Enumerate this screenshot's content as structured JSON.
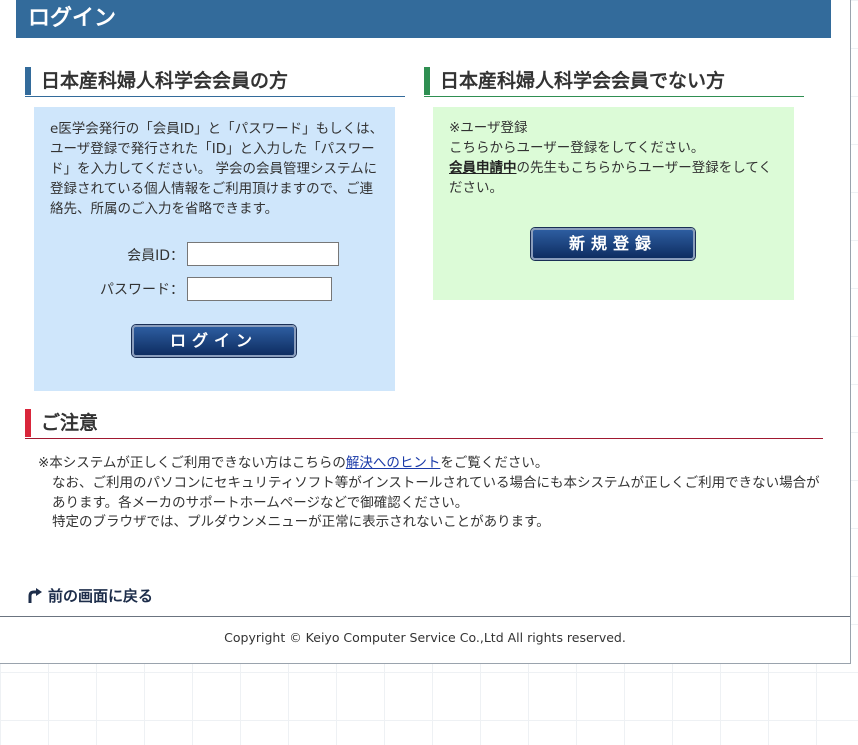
{
  "header": {
    "title": "ログイン"
  },
  "member_section": {
    "heading": "日本産科婦人科学会会員の方",
    "intro": "e医学会発行の「会員ID」と「パスワード」もしくは、ユーザ登録で発行された「ID」と入力した「パスワード」を入力してください。 学会の会員管理システムに登録されている個人情報をご利用頂けますので、ご連絡先、所属のご入力を省略できます。",
    "member_id_label": "会員ID：",
    "password_label": "パスワード：",
    "member_id_value": "",
    "password_value": "",
    "login_button": "ログイン"
  },
  "nonmember_section": {
    "heading": "日本産科婦人科学会会員でない方",
    "line1": "※ユーザ登録",
    "line2": "こちらからユーザー登録をしてください。",
    "line3_link": "会員申請中",
    "line3_rest": "の先生もこちらからユーザー登録をしてください。",
    "register_button": "新規登録"
  },
  "notice_section": {
    "heading": "ご注意",
    "line1_prefix": "※本システムが正しくご利用できない方はこちらの",
    "line1_link": "解決へのヒント",
    "line1_suffix": "をご覧ください。",
    "line2": "なお、ご利用のパソコンにセキュリティソフト等がインストールされている場合にも本システムが正しくご利用できない場合があります。各メーカのサポートホームページなどで御確認ください。",
    "line3": "特定のブラウザでは、プルダウンメニューが正常に表示されないことがあります。"
  },
  "back_link": "前の画面に戻る",
  "footer": {
    "copyright": "Copyright © Keiyo Computer Service Co.,Ltd All rights reserved."
  }
}
